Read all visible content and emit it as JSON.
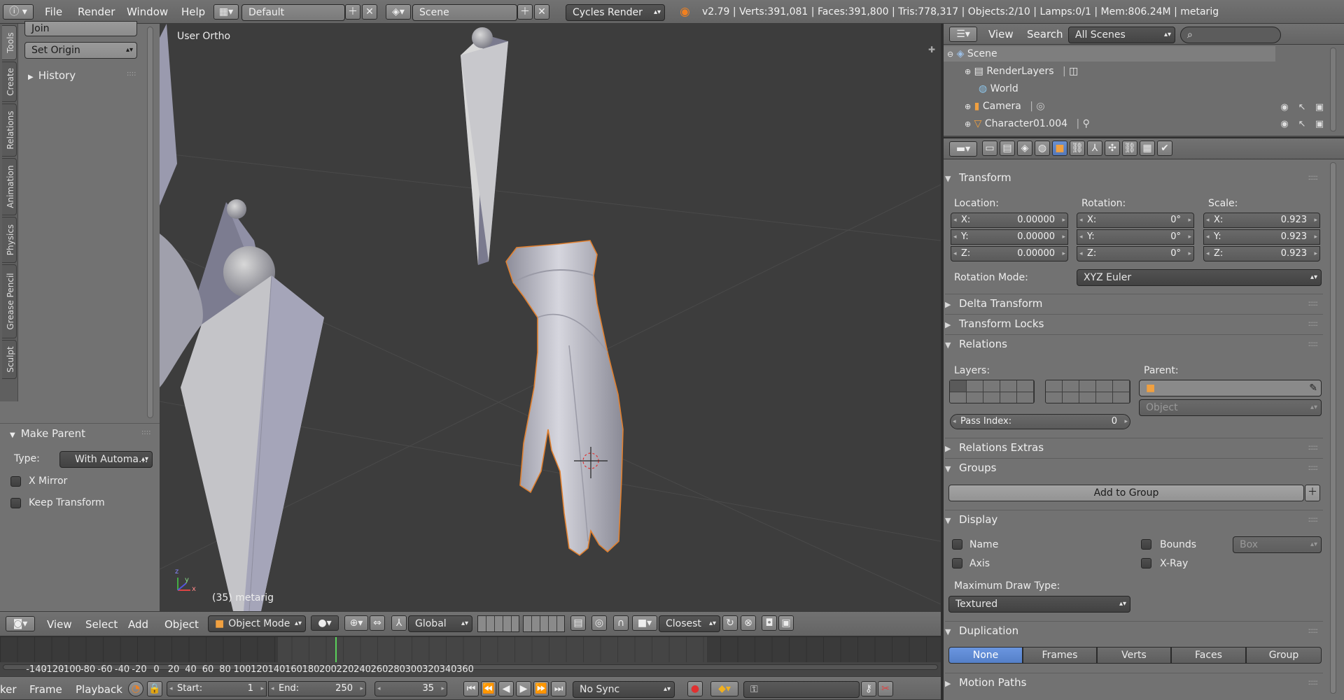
{
  "topbar": {
    "menus": [
      "File",
      "Render",
      "Window",
      "Help"
    ],
    "layout": "Default",
    "scene": "Scene",
    "engine": "Cycles Render",
    "stats": "v2.79 | Verts:391,081 | Faces:391,800 | Tris:778,317 | Objects:2/10 | Lamps:0/1 | Mem:806.24M | metarig"
  },
  "toolshelf": {
    "tabs": [
      "Tools",
      "Create",
      "Relations",
      "Animation",
      "Physics",
      "Grease Pencil",
      "Sculpt"
    ],
    "join": "Join",
    "set_origin": "Set Origin",
    "history": "History",
    "operator": {
      "title": "Make Parent",
      "type_label": "Type:",
      "type_value": "With Automa...",
      "x_mirror": "X Mirror",
      "keep_transform": "Keep Transform"
    }
  },
  "viewport": {
    "view_label": "User Ortho",
    "object_label": "(35) metarig",
    "axis_x": "x",
    "axis_y": "y",
    "axis_z": "z",
    "header": {
      "menus": [
        "View",
        "Select",
        "Add",
        "Object"
      ],
      "mode": "Object Mode",
      "orientation": "Global",
      "snap": "Closest"
    }
  },
  "timeline": {
    "ticks": [
      "-140",
      "-120",
      "-100",
      "-80",
      "-60",
      "-40",
      "-20",
      "0",
      "20",
      "40",
      "60",
      "80",
      "100",
      "120",
      "140",
      "160",
      "180",
      "200",
      "220",
      "240",
      "260",
      "280",
      "300",
      "320",
      "340",
      "360"
    ],
    "current_frame": 35,
    "menus_cut": "ker",
    "menus": [
      "Frame",
      "Playback"
    ],
    "start_label": "Start:",
    "start": "1",
    "end_label": "End:",
    "end": "250",
    "frame": "35",
    "sync": "No Sync"
  },
  "outliner": {
    "menus": [
      "View",
      "Search"
    ],
    "filter": "All Scenes",
    "items": [
      "Scene",
      "RenderLayers",
      "World",
      "Camera",
      "Character01.004"
    ]
  },
  "properties": {
    "transform": {
      "title": "Transform",
      "location_label": "Location:",
      "rotation_label": "Rotation:",
      "scale_label": "Scale:",
      "location": [
        "0.00000",
        "0.00000",
        "0.00000"
      ],
      "rotation": [
        "0°",
        "0°",
        "0°"
      ],
      "scale": [
        "0.923",
        "0.923",
        "0.923"
      ],
      "axes": [
        "X:",
        "Y:",
        "Z:"
      ],
      "rotation_mode_label": "Rotation Mode:",
      "rotation_mode": "XYZ Euler"
    },
    "delta_transform": "Delta Transform",
    "transform_locks": "Transform Locks",
    "relations": {
      "title": "Relations",
      "layers_label": "Layers:",
      "parent_label": "Parent:",
      "parent_type": "Object",
      "pass_index_label": "Pass Index:",
      "pass_index": "0"
    },
    "relations_extras": "Relations Extras",
    "groups": {
      "title": "Groups",
      "add": "Add to Group"
    },
    "display": {
      "title": "Display",
      "name": "Name",
      "axis": "Axis",
      "bounds": "Bounds",
      "bounds_type": "Box",
      "xray": "X-Ray",
      "max_draw_label": "Maximum Draw Type:",
      "max_draw": "Textured"
    },
    "duplication": {
      "title": "Duplication",
      "options": [
        "None",
        "Frames",
        "Verts",
        "Faces",
        "Group"
      ],
      "selected": "None"
    },
    "motion_paths": "Motion Paths"
  }
}
